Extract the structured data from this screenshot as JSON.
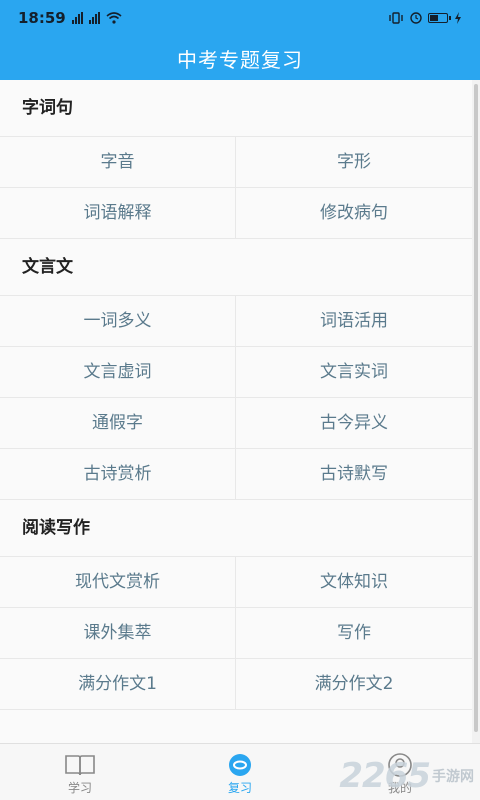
{
  "status_bar": {
    "time": "18:59"
  },
  "header": {
    "title": "中考专题复习"
  },
  "sections": [
    {
      "title": "字词句",
      "items": [
        "字音",
        "字形",
        "词语解释",
        "修改病句"
      ]
    },
    {
      "title": "文言文",
      "items": [
        "一词多义",
        "词语活用",
        "文言虚词",
        "文言实词",
        "通假字",
        "古今异义",
        "古诗赏析",
        "古诗默写"
      ]
    },
    {
      "title": "阅读写作",
      "items": [
        "现代文赏析",
        "文体知识",
        "课外集萃",
        "写作",
        "满分作文1",
        "满分作文2"
      ]
    }
  ],
  "tabbar": {
    "tabs": [
      {
        "label": "学习",
        "icon": "book-icon",
        "active": false
      },
      {
        "label": "复习",
        "icon": "review-icon",
        "active": true
      },
      {
        "label": "我的",
        "icon": "profile-icon",
        "active": false
      }
    ],
    "accent_color": "#2aa6f0"
  },
  "watermark": {
    "number": "2265",
    "text": "手游网"
  },
  "colors": {
    "header_bg": "#2aa6f0",
    "item_text": "#5a7a8c"
  }
}
